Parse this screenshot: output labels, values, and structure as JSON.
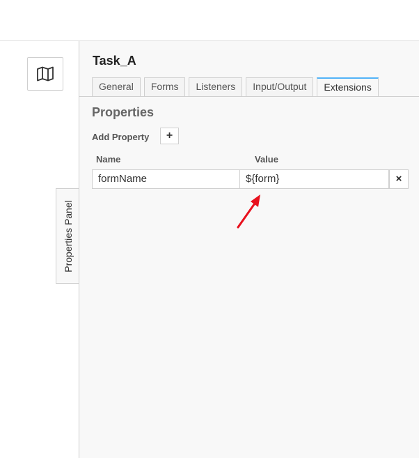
{
  "sidebar": {
    "toggle_label": "Properties Panel"
  },
  "panel": {
    "title": "Task_A",
    "tabs": [
      {
        "label": "General",
        "active": false
      },
      {
        "label": "Forms",
        "active": false
      },
      {
        "label": "Listeners",
        "active": false
      },
      {
        "label": "Input/Output",
        "active": false
      },
      {
        "label": "Extensions",
        "active": true
      }
    ],
    "section_title": "Properties",
    "add_property_label": "Add Property",
    "add_button_label": "+",
    "columns": {
      "name": "Name",
      "value": "Value"
    },
    "rows": [
      {
        "name": "formName",
        "value": "${form}",
        "delete_label": "×"
      }
    ]
  },
  "colors": {
    "active_tab_accent": "#52b3f8",
    "annotation_arrow": "#e8101d"
  },
  "icons": {
    "map_button": "map-icon"
  }
}
